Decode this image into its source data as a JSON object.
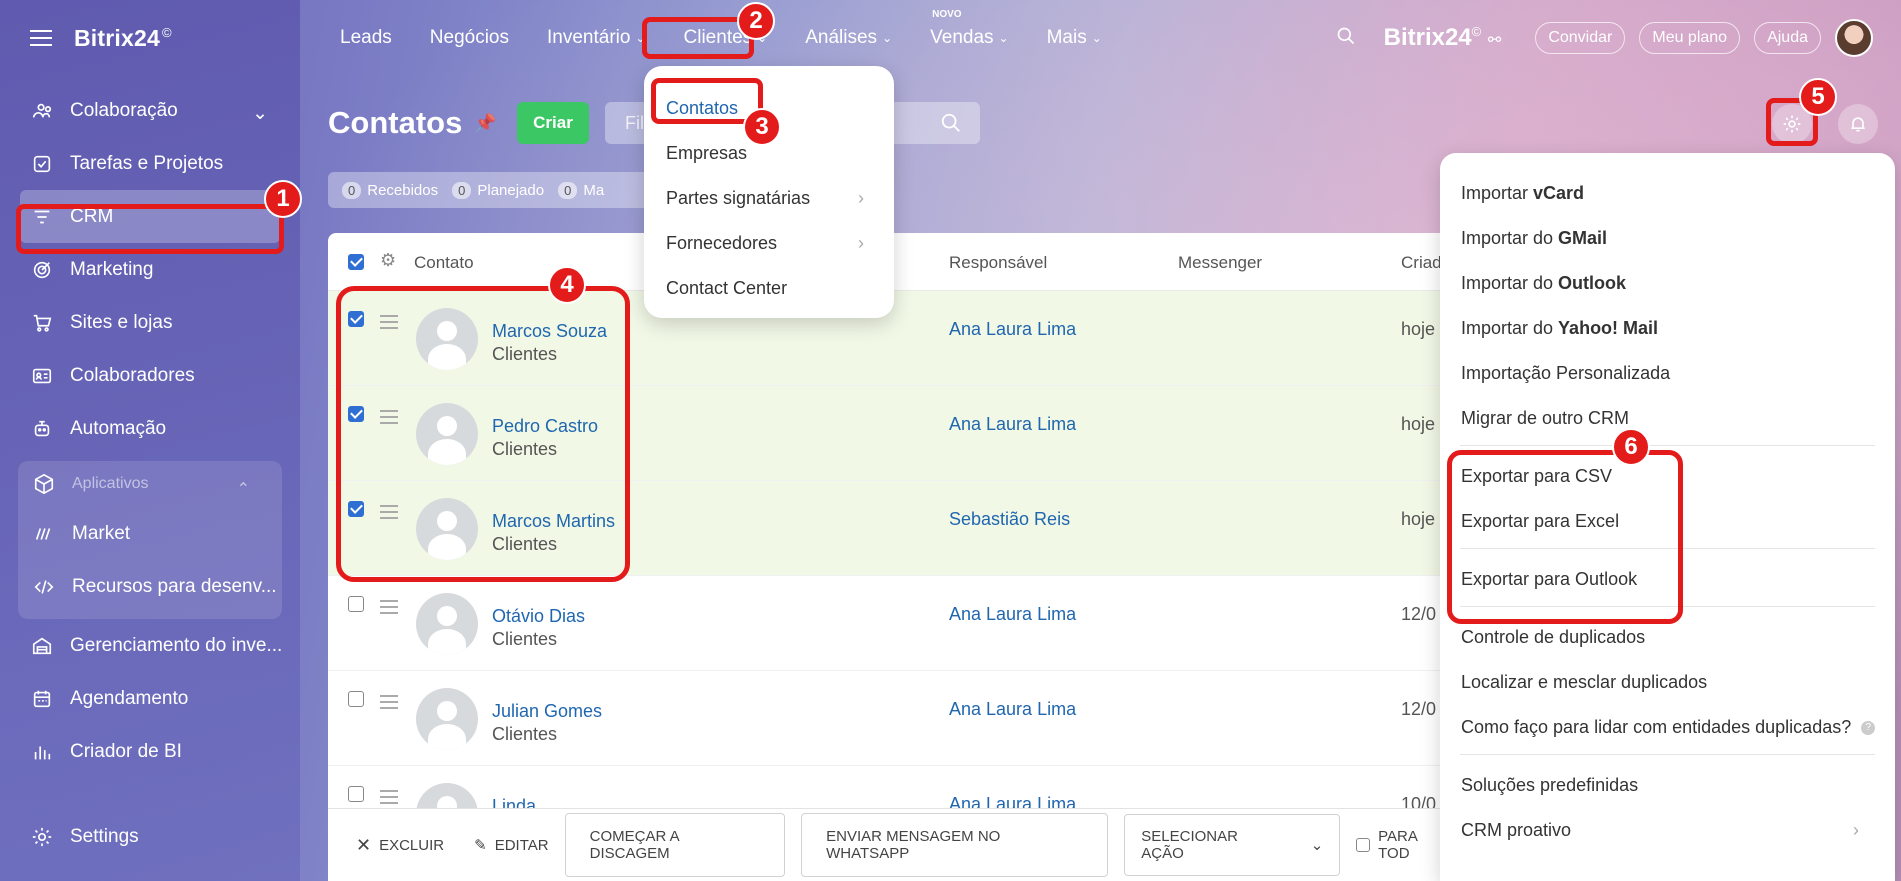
{
  "sidebar": {
    "logo": "Bitrix24",
    "logo_mark": "©",
    "items": [
      {
        "label": "Colaboração",
        "icon": "collaboration-icon",
        "has_chevron": true
      },
      {
        "label": "Tarefas e Projetos",
        "icon": "tasks-icon"
      },
      {
        "label": "CRM",
        "icon": "crm-filter-icon",
        "active": true
      },
      {
        "label": "Marketing",
        "icon": "marketing-icon"
      },
      {
        "label": "Sites e lojas",
        "icon": "cart-icon"
      },
      {
        "label": "Colaboradores",
        "icon": "employees-icon"
      },
      {
        "label": "Automação",
        "icon": "robot-icon"
      }
    ],
    "apps_header": "Aplicativos",
    "apps_items": [
      {
        "label": "Market",
        "icon": "market-icon"
      },
      {
        "label": "Recursos para desenv...",
        "icon": "code-icon"
      }
    ],
    "more_items": [
      {
        "label": "Gerenciamento do inve...",
        "icon": "warehouse-icon"
      },
      {
        "label": "Agendamento",
        "icon": "calendar-icon"
      },
      {
        "label": "Criador de BI",
        "icon": "bi-chart-icon"
      }
    ],
    "settings": "Settings"
  },
  "topnav": {
    "items": [
      {
        "label": "Leads",
        "caret": false
      },
      {
        "label": "Negócios",
        "caret": false
      },
      {
        "label": "Inventário",
        "caret": true
      },
      {
        "label": "Clientes",
        "caret": true
      },
      {
        "label": "Análises",
        "caret": true
      },
      {
        "label": "Vendas",
        "caret": true,
        "badge": "NOVO"
      },
      {
        "label": "Mais",
        "caret": true
      }
    ],
    "brand": "Bitrix24",
    "invite": "Convidar",
    "plan": "Meu plano",
    "help": "Ajuda"
  },
  "page": {
    "title": "Contatos",
    "create": "Criar",
    "search_placeholder": "Fil",
    "counters": [
      {
        "num": "0",
        "label": "Recebidos"
      },
      {
        "num": "0",
        "label": "Planejado"
      },
      {
        "num": "0",
        "label": "Ma"
      }
    ]
  },
  "table": {
    "headers": {
      "contact": "Contato",
      "responsible": "Responsável",
      "messenger": "Messenger",
      "created": "Criad"
    },
    "rows": [
      {
        "name": "Marcos Souza",
        "type": "Clientes",
        "responsible": "Ana Laura Lima",
        "date": "hoje",
        "checked": true
      },
      {
        "name": "Pedro Castro",
        "type": "Clientes",
        "responsible": "Ana Laura Lima",
        "date": "hoje",
        "checked": true
      },
      {
        "name": "Marcos Martins",
        "type": "Clientes",
        "responsible": "Sebastião Reis",
        "date": "hoje",
        "checked": true
      },
      {
        "name": "Otávio Dias",
        "type": "Clientes",
        "responsible": "Ana Laura Lima",
        "date": "12/0",
        "checked": false
      },
      {
        "name": "Julian Gomes",
        "type": "Clientes",
        "responsible": "Ana Laura Lima",
        "date": "12/0",
        "checked": false
      },
      {
        "name": "Linda",
        "type": "",
        "responsible": "Ana Laura Lima",
        "date": "10/0",
        "checked": false
      }
    ]
  },
  "bottom_bar": {
    "delete": "EXCLUIR",
    "edit": "EDITAR",
    "dial": "COMEÇAR A DISCAGEM",
    "whatsapp": "ENVIAR MENSAGEM NO WHATSAPP",
    "select_action": "SELECIONAR AÇÃO",
    "for_all": "PARA TOD"
  },
  "clientes_menu": {
    "items": [
      {
        "label": "Contatos",
        "active": true,
        "arrow": false
      },
      {
        "label": "Empresas",
        "arrow": false
      },
      {
        "label": "Partes signatárias",
        "arrow": true
      },
      {
        "label": "Fornecedores",
        "arrow": true
      },
      {
        "label": "Contact Center",
        "arrow": false
      }
    ]
  },
  "settings_menu": {
    "import": [
      {
        "prefix": "Importar",
        "bold": "vCard"
      },
      {
        "prefix": "Importar do",
        "bold": "GMail"
      },
      {
        "prefix": "Importar do",
        "bold": "Outlook"
      },
      {
        "prefix": "Importar do",
        "bold": "Yahoo! Mail"
      },
      {
        "prefix": "Importação Personalizada",
        "bold": ""
      },
      {
        "prefix": "Migrar de outro CRM",
        "bold": ""
      }
    ],
    "export_csv": "Exportar para CSV",
    "export_excel": "Exportar para Excel",
    "export_outlook": "Exportar para Outlook",
    "dup_control": "Controle de duplicados",
    "dup_find": "Localizar e mesclar duplicados",
    "dup_help": "Como faço para lidar com entidades duplicadas?",
    "solutions": "Soluções predefinidas",
    "proactive": "CRM proativo"
  },
  "annotations": [
    "1",
    "2",
    "3",
    "4",
    "5",
    "6"
  ],
  "colors": {
    "annotation_red": "#e41b1b",
    "create_green": "#3bc764",
    "link_blue": "#2067b0"
  }
}
